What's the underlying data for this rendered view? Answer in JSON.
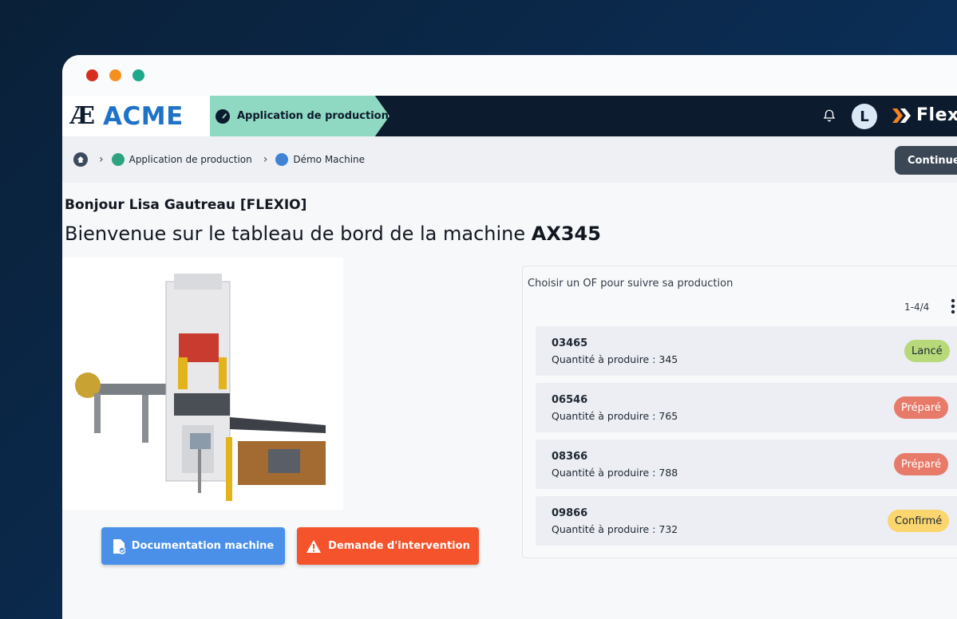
{
  "app": {
    "logo_mark": "Æ",
    "logo_name": "ACME",
    "title": "Application de production",
    "avatar_initial": "L",
    "brand": "Flex"
  },
  "breadcrumb": {
    "items": [
      "Application de production",
      "Démo Machine"
    ],
    "continue_label": "Continuer"
  },
  "main": {
    "greeting": "Bonjour Lisa Gautreau [FLEXIO]",
    "headline_prefix": "Bienvenue sur le tableau de bord de la machine ",
    "machine_code": "AX345",
    "doc_button": "Documentation machine",
    "intervention_button": "Demande d'intervention"
  },
  "of_panel": {
    "title": "Choisir un OF pour suivre sa production",
    "pagination": "1-4/4",
    "items": [
      {
        "code": "03465",
        "qty": "Quantité à produire : 345",
        "status": "Lancé"
      },
      {
        "code": "06546",
        "qty": "Quantité à produire : 765",
        "status": "Préparé"
      },
      {
        "code": "08366",
        "qty": "Quantité à produire : 788",
        "status": "Préparé"
      },
      {
        "code": "09866",
        "qty": "Quantité à produire : 732",
        "status": "Confirmé"
      }
    ]
  },
  "colors": {
    "navbar": "#0c1b2d",
    "accent_mint": "#8fd8c1",
    "brand_blue": "#1e73c8",
    "doc_button": "#4a90e8",
    "intervention_button": "#f4532c",
    "status_launched": "#b8d97a",
    "status_prepared": "#e87a6a",
    "status_confirmed": "#fbd66e"
  }
}
